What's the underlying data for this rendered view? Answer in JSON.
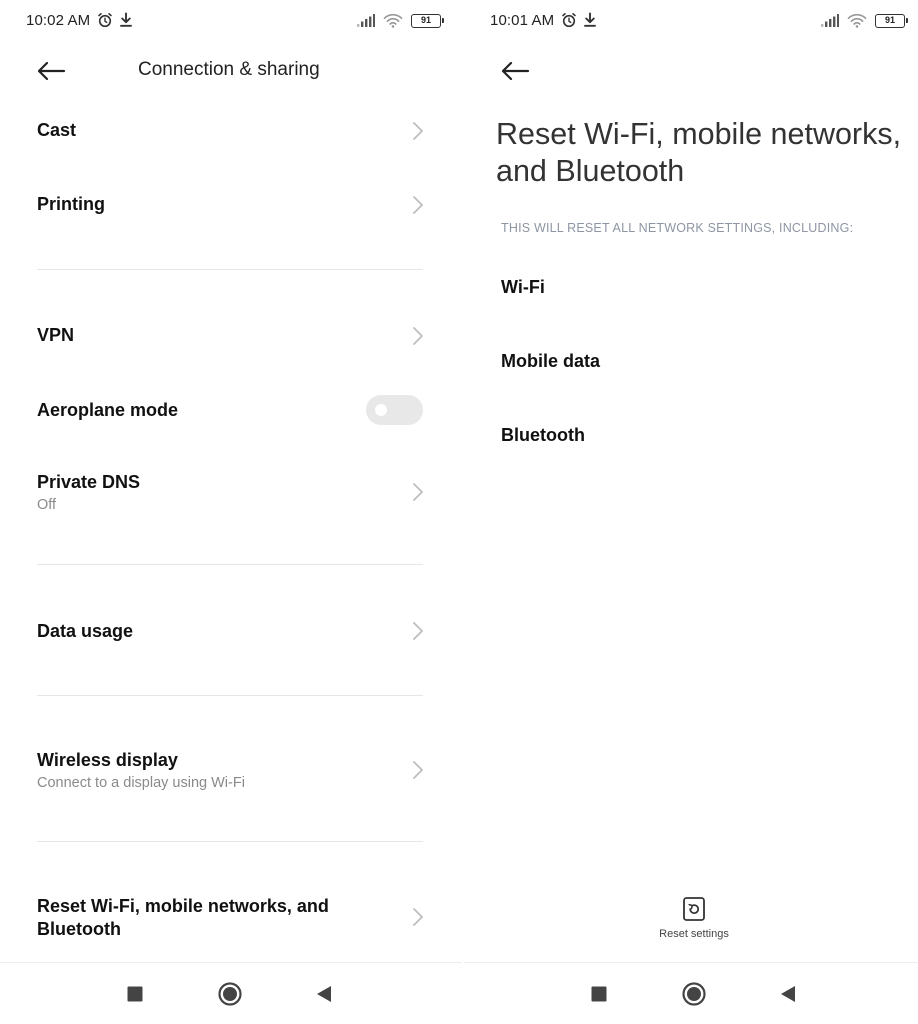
{
  "left": {
    "status_bar": {
      "time": "10:02 AM",
      "battery": "91"
    },
    "header": {
      "title": "Connection & sharing"
    },
    "items": [
      {
        "title": "Cast"
      },
      {
        "title": "Printing"
      },
      {
        "title": "VPN"
      },
      {
        "title": "Aeroplane mode",
        "toggle_on": false
      },
      {
        "title": "Private DNS",
        "subtitle": "Off"
      },
      {
        "title": "Data usage"
      },
      {
        "title": "Wireless display",
        "subtitle": "Connect to a display using Wi-Fi"
      },
      {
        "title_line1": "Reset Wi-Fi, mobile networks, and",
        "title_line2": "Bluetooth"
      }
    ]
  },
  "right": {
    "status_bar": {
      "time": "10:01 AM",
      "battery": "91"
    },
    "heading_line1": "Reset Wi-Fi, mobile networks,",
    "heading_line2": "and Bluetooth",
    "caption": "THIS WILL RESET ALL NETWORK SETTINGS, INCLUDING:",
    "entries": [
      "Wi-Fi",
      "Mobile data",
      "Bluetooth"
    ],
    "action": {
      "label": "Reset settings",
      "icon": "reset-icon"
    }
  },
  "icons": {
    "status": [
      "alarm-icon",
      "download-icon",
      "signal-icon",
      "wifi-icon",
      "battery-icon"
    ],
    "nav": [
      "recents-square-icon",
      "home-circle-icon",
      "back-triangle-icon"
    ]
  },
  "colors": {
    "toggle_off": "#e8e8e8",
    "subtitle": "#8a8a8a",
    "caption": "#8e95a3"
  }
}
